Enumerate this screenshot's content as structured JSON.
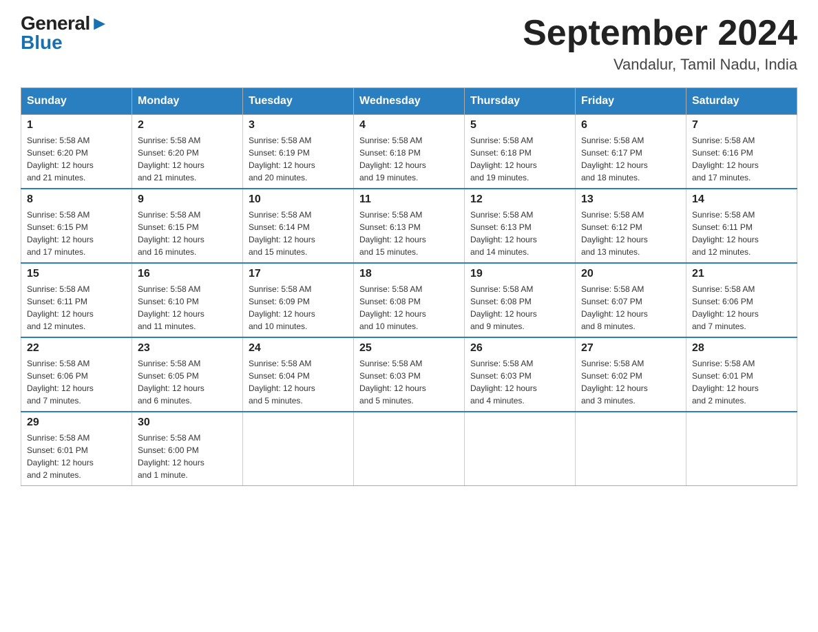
{
  "header": {
    "logo_general": "General",
    "logo_blue": "Blue",
    "title": "September 2024",
    "subtitle": "Vandalur, Tamil Nadu, India"
  },
  "days_of_week": [
    "Sunday",
    "Monday",
    "Tuesday",
    "Wednesday",
    "Thursday",
    "Friday",
    "Saturday"
  ],
  "weeks": [
    [
      {
        "num": "1",
        "sunrise": "5:58 AM",
        "sunset": "6:20 PM",
        "daylight": "12 hours and 21 minutes."
      },
      {
        "num": "2",
        "sunrise": "5:58 AM",
        "sunset": "6:20 PM",
        "daylight": "12 hours and 21 minutes."
      },
      {
        "num": "3",
        "sunrise": "5:58 AM",
        "sunset": "6:19 PM",
        "daylight": "12 hours and 20 minutes."
      },
      {
        "num": "4",
        "sunrise": "5:58 AM",
        "sunset": "6:18 PM",
        "daylight": "12 hours and 19 minutes."
      },
      {
        "num": "5",
        "sunrise": "5:58 AM",
        "sunset": "6:18 PM",
        "daylight": "12 hours and 19 minutes."
      },
      {
        "num": "6",
        "sunrise": "5:58 AM",
        "sunset": "6:17 PM",
        "daylight": "12 hours and 18 minutes."
      },
      {
        "num": "7",
        "sunrise": "5:58 AM",
        "sunset": "6:16 PM",
        "daylight": "12 hours and 17 minutes."
      }
    ],
    [
      {
        "num": "8",
        "sunrise": "5:58 AM",
        "sunset": "6:15 PM",
        "daylight": "12 hours and 17 minutes."
      },
      {
        "num": "9",
        "sunrise": "5:58 AM",
        "sunset": "6:15 PM",
        "daylight": "12 hours and 16 minutes."
      },
      {
        "num": "10",
        "sunrise": "5:58 AM",
        "sunset": "6:14 PM",
        "daylight": "12 hours and 15 minutes."
      },
      {
        "num": "11",
        "sunrise": "5:58 AM",
        "sunset": "6:13 PM",
        "daylight": "12 hours and 15 minutes."
      },
      {
        "num": "12",
        "sunrise": "5:58 AM",
        "sunset": "6:13 PM",
        "daylight": "12 hours and 14 minutes."
      },
      {
        "num": "13",
        "sunrise": "5:58 AM",
        "sunset": "6:12 PM",
        "daylight": "12 hours and 13 minutes."
      },
      {
        "num": "14",
        "sunrise": "5:58 AM",
        "sunset": "6:11 PM",
        "daylight": "12 hours and 12 minutes."
      }
    ],
    [
      {
        "num": "15",
        "sunrise": "5:58 AM",
        "sunset": "6:11 PM",
        "daylight": "12 hours and 12 minutes."
      },
      {
        "num": "16",
        "sunrise": "5:58 AM",
        "sunset": "6:10 PM",
        "daylight": "12 hours and 11 minutes."
      },
      {
        "num": "17",
        "sunrise": "5:58 AM",
        "sunset": "6:09 PM",
        "daylight": "12 hours and 10 minutes."
      },
      {
        "num": "18",
        "sunrise": "5:58 AM",
        "sunset": "6:08 PM",
        "daylight": "12 hours and 10 minutes."
      },
      {
        "num": "19",
        "sunrise": "5:58 AM",
        "sunset": "6:08 PM",
        "daylight": "12 hours and 9 minutes."
      },
      {
        "num": "20",
        "sunrise": "5:58 AM",
        "sunset": "6:07 PM",
        "daylight": "12 hours and 8 minutes."
      },
      {
        "num": "21",
        "sunrise": "5:58 AM",
        "sunset": "6:06 PM",
        "daylight": "12 hours and 7 minutes."
      }
    ],
    [
      {
        "num": "22",
        "sunrise": "5:58 AM",
        "sunset": "6:06 PM",
        "daylight": "12 hours and 7 minutes."
      },
      {
        "num": "23",
        "sunrise": "5:58 AM",
        "sunset": "6:05 PM",
        "daylight": "12 hours and 6 minutes."
      },
      {
        "num": "24",
        "sunrise": "5:58 AM",
        "sunset": "6:04 PM",
        "daylight": "12 hours and 5 minutes."
      },
      {
        "num": "25",
        "sunrise": "5:58 AM",
        "sunset": "6:03 PM",
        "daylight": "12 hours and 5 minutes."
      },
      {
        "num": "26",
        "sunrise": "5:58 AM",
        "sunset": "6:03 PM",
        "daylight": "12 hours and 4 minutes."
      },
      {
        "num": "27",
        "sunrise": "5:58 AM",
        "sunset": "6:02 PM",
        "daylight": "12 hours and 3 minutes."
      },
      {
        "num": "28",
        "sunrise": "5:58 AM",
        "sunset": "6:01 PM",
        "daylight": "12 hours and 2 minutes."
      }
    ],
    [
      {
        "num": "29",
        "sunrise": "5:58 AM",
        "sunset": "6:01 PM",
        "daylight": "12 hours and 2 minutes."
      },
      {
        "num": "30",
        "sunrise": "5:58 AM",
        "sunset": "6:00 PM",
        "daylight": "12 hours and 1 minute."
      },
      null,
      null,
      null,
      null,
      null
    ]
  ],
  "labels": {
    "sunrise": "Sunrise:",
    "sunset": "Sunset:",
    "daylight": "Daylight:"
  }
}
